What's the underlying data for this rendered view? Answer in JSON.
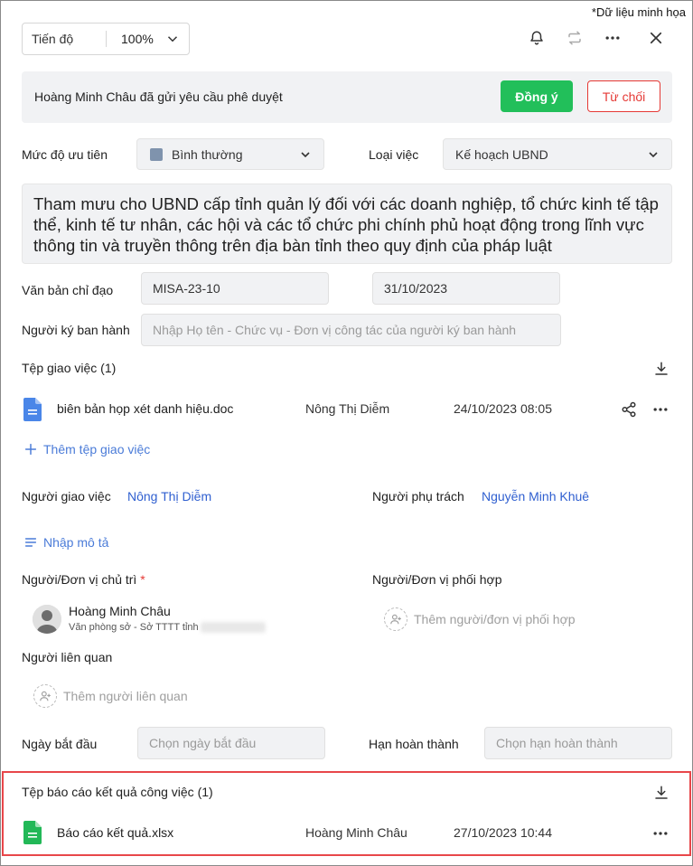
{
  "watermark": "*Dữ liệu minh họa",
  "header": {
    "progress_label": "Tiến độ",
    "zoom": "100%"
  },
  "approval": {
    "requester": "Hoàng Minh Châu",
    "message": "đã gửi yêu cầu phê duyệt",
    "accept_label": "Đồng ý",
    "reject_label": "Từ chối"
  },
  "priority": {
    "label": "Mức độ ưu tiên",
    "value": "Bình thường"
  },
  "task_type": {
    "label": "Loại việc",
    "value": "Kế hoạch UBND"
  },
  "task_title": "Tham mưu cho UBND cấp tỉnh quản lý đối với các doanh nghiệp, tổ chức kinh tế tập thể, kinh tế tư nhân, các hội và các tổ chức phi chính phủ hoạt động trong lĩnh vực thông tin và truyền thông trên địa bàn tỉnh theo quy định của pháp luật",
  "directive": {
    "label": "Văn bản chỉ đạo",
    "number": "MISA-23-10",
    "date": "31/10/2023"
  },
  "signer": {
    "label": "Người ký ban hành",
    "placeholder": "Nhập Họ tên - Chức vụ - Đơn vị công tác của người ký ban hành"
  },
  "assignment_files": {
    "title": "Tệp giao việc (1)",
    "files": [
      {
        "name": "biên bản họp xét danh hiệu.doc",
        "owner": "Nông Thị Diễm",
        "date": "24/10/2023 08:05"
      }
    ],
    "add_label": "Thêm tệp giao việc"
  },
  "assigner": {
    "label": "Người giao việc",
    "value": "Nông Thị Diễm"
  },
  "owner": {
    "label": "Người phụ trách",
    "value": "Nguyễn Minh Khuê"
  },
  "description_link": "Nhập mô tả",
  "lead": {
    "label": "Người/Đơn vị chủ trì",
    "required_mark": "*",
    "name": "Hoàng Minh Châu",
    "unit": "Văn phòng sở - Sở TTTT tỉnh"
  },
  "coordinator": {
    "label": "Người/Đơn vị phối hợp",
    "placeholder": "Thêm người/đơn vị phối hợp"
  },
  "related": {
    "label": "Người liên quan",
    "placeholder": "Thêm người liên quan"
  },
  "start_date": {
    "label": "Ngày bắt đầu",
    "placeholder": "Chọn ngày bắt đầu"
  },
  "due_date": {
    "label": "Hạn hoàn thành",
    "placeholder": "Chọn hạn hoàn thành"
  },
  "result_files": {
    "title": "Tệp báo cáo kết quả công việc (1)",
    "files": [
      {
        "name": "Báo cáo kết quả.xlsx",
        "owner": "Hoàng Minh Châu",
        "date": "27/10/2023 10:44"
      }
    ]
  },
  "colors": {
    "accept": "#22bf5a",
    "reject": "#e53935",
    "link": "#2f5fd0",
    "highlight": "#e8474a",
    "doc_icon": "#4a86e8",
    "xlsx_icon": "#22b857"
  }
}
